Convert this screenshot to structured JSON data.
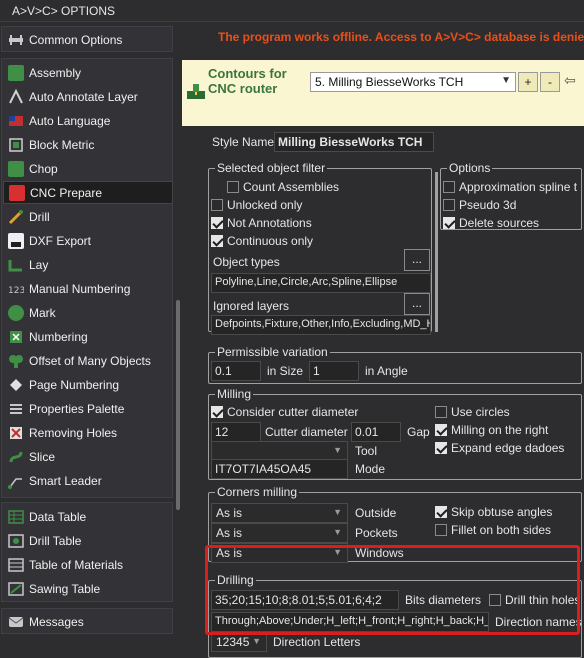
{
  "window": {
    "title": "A>V>C> OPTIONS"
  },
  "notice": "The program works offline. Access to A>V>C> database is denied.",
  "sidebar": {
    "common": "Common Options",
    "tools": [
      "Assembly",
      "Auto Annotate Layer",
      "Auto Language",
      "Block Metric",
      "Chop",
      "CNC Prepare",
      "Drill",
      "DXF Export",
      "Lay",
      "Manual Numbering",
      "Mark",
      "Numbering",
      "Offset of Many Objects",
      "Page Numbering",
      "Properties Palette",
      "Removing Holes",
      "Slice",
      "Smart Leader"
    ],
    "tables": [
      "Data Table",
      "Drill Table",
      "Table of Materials",
      "Sawing Table"
    ],
    "messages": "Messages",
    "active": "CNC Prepare"
  },
  "header": {
    "title": "Contours for CNC router",
    "preset": "5. Milling BiesseWorks TCH",
    "add_label": "+",
    "remove_label": "-",
    "back_icon": "back-arrow-icon"
  },
  "style_name": {
    "label": "Style Name",
    "value": "Milling BiesseWorks TCH"
  },
  "filter": {
    "legend": "Selected object filter",
    "count_assemblies": "Count Assemblies",
    "unlocked_only": "Unlocked only",
    "not_annotations": "Not Annotations",
    "continuous_only": "Continuous only",
    "object_types_label": "Object types",
    "object_types_value": "Polyline,Line,Circle,Arc,Spline,Ellipse",
    "ignored_layers_label": "Ignored layers",
    "ignored_layers_value": "Defpoints,Fixture,Other,Info,Excluding,MD_Hi",
    "dots": "..."
  },
  "options": {
    "legend": "Options",
    "approx_spline": "Approximation spline t",
    "pseudo3d": "Pseudo 3d",
    "delete_sources": "Delete sources"
  },
  "variation": {
    "legend": "Permissible variation",
    "size_value": "0.1",
    "size_label": "in Size",
    "angle_value": "1",
    "angle_label": "in Angle"
  },
  "milling": {
    "legend": "Milling",
    "consider_diameter": "Consider cutter diameter",
    "use_circles": "Use circles",
    "diameter_value": "12",
    "diameter_label": "Cutter diameter",
    "gap_value": "0.01",
    "gap_label": "Gap",
    "milling_right": "Milling on the right",
    "tool_label": "Tool",
    "expand_dadoes": "Expand edge dadoes",
    "mode_value": "IT7OT7IA45OA45",
    "mode_label": "Mode"
  },
  "corners": {
    "legend": "Corners milling",
    "outside_value": "As is",
    "outside_label": "Outside",
    "pockets_value": "As is",
    "pockets_label": "Pockets",
    "windows_value": "As is",
    "windows_label": "Windows",
    "skip_obtuse": "Skip obtuse angles",
    "fillet_both": "Fillet on both sides"
  },
  "drilling": {
    "legend": "Drilling",
    "bits_value": "35;20;15;10;8;8.01;5;5.01;6;4;2",
    "bits_label": "Bits diameters",
    "drill_thin": "Drill thin holes",
    "directions_value": "Through;Above;Under;H_left;H_front;H_right;H_back;H_ot",
    "directions_label": "Direction names",
    "letters_value": "12345",
    "letters_label": "Direction Letters"
  },
  "colors": {
    "warning": "#e8501a",
    "header_bg": "#faf6d2",
    "header_title": "#3a7540",
    "highlight": "#d81e1e"
  }
}
